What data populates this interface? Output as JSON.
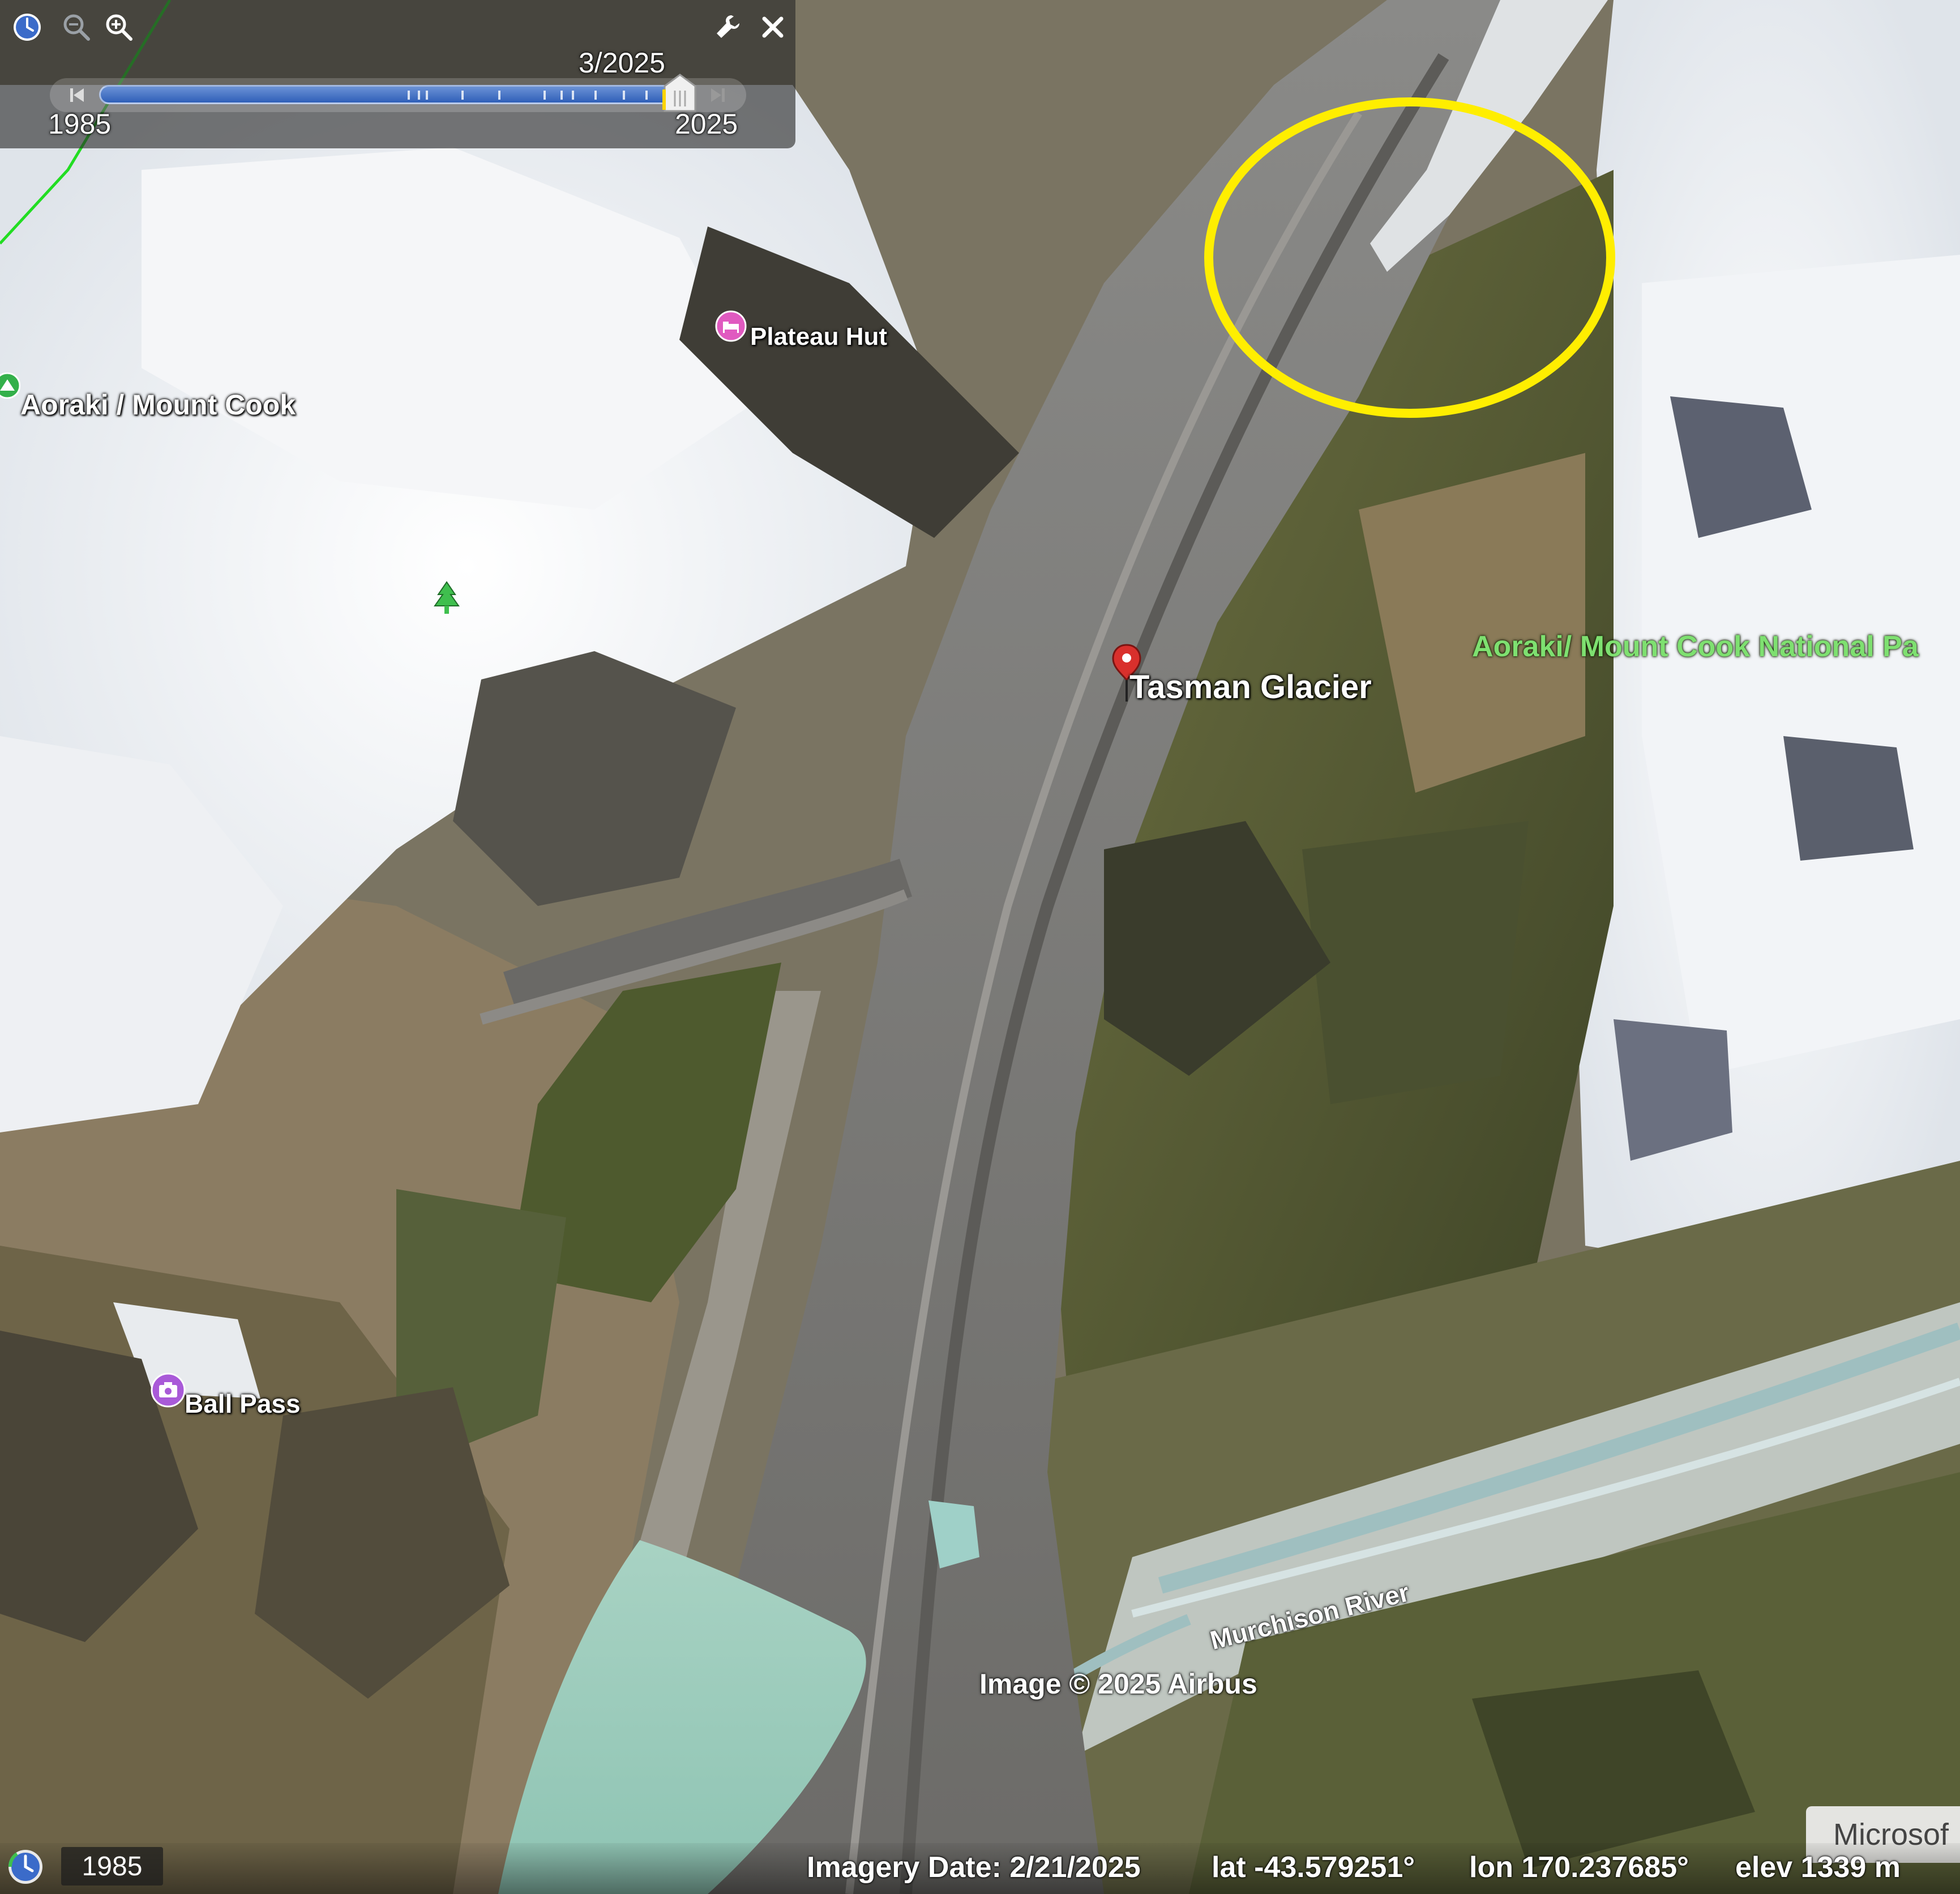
{
  "time_slider": {
    "current_date": "3/2025",
    "start_year": "1985",
    "end_year": "2025",
    "position_fraction": 0.975
  },
  "map": {
    "labels": {
      "glacier": "Tasman Glacier",
      "hut": "Plateau Hut",
      "mountain": "Aoraki / Mount Cook",
      "pass": "Ball Pass",
      "park": "Aoraki/ Mount Cook National Pa",
      "river": "Murchison River"
    },
    "attribution": "Image © 2025 Airbus",
    "highlight_color": "#ffee00",
    "pin_color": "#d9302c"
  },
  "status_bar": {
    "history_year": "1985",
    "imagery_date": "Imagery Date: 2/21/2025",
    "lat": "lat  -43.579251°",
    "lon": "lon  170.237685°",
    "elev": "elev  1339 m"
  },
  "brand_badge": "Microsof",
  "icons": {
    "history": "clock-icon",
    "zoom_out": "zoom-out-icon",
    "zoom_in": "zoom-in-icon",
    "settings": "wrench-icon",
    "close": "close-icon"
  }
}
